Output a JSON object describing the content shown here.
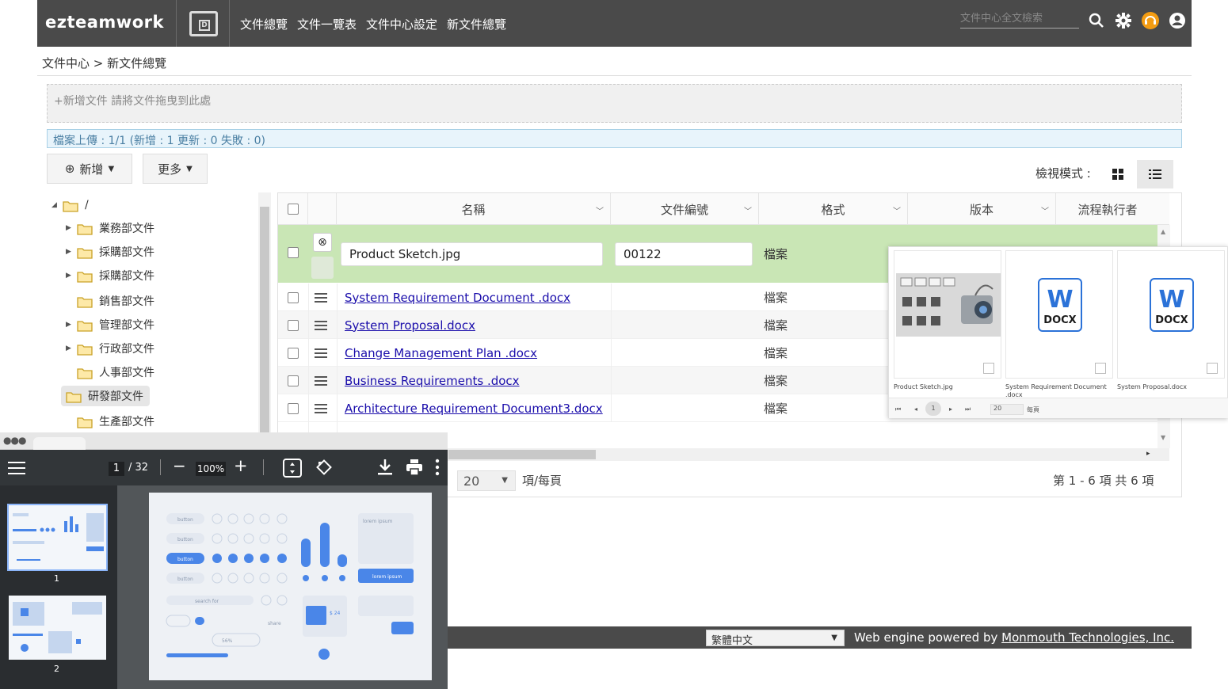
{
  "app": {
    "logo": "ezteamwork",
    "logo_badge": "D",
    "nav": [
      "文件總覽",
      "文件一覽表",
      "文件中心設定",
      "新文件總覽"
    ],
    "search_placeholder": "文件中心全文檢索"
  },
  "breadcrumb": "文件中心 > 新文件總覽",
  "dropzone_text": "+新增文件 請將文件拖曳到此處",
  "upload_status": "檔案上傳 : 1/1 (新增 : 1 更新 : 0 失敗 : 0)",
  "toolbar": {
    "add_label": "新增",
    "more_label": "更多",
    "view_mode_label": "檢視模式 :"
  },
  "tree": {
    "root": "/",
    "items": [
      "業務部文件",
      "採購部文件",
      "採購部文件",
      "銷售部文件",
      "管理部文件",
      "行政部文件",
      "人事部文件",
      "研發部文件",
      "生產部文件"
    ]
  },
  "table": {
    "headers": [
      "名稱",
      "文件編號",
      "格式",
      "版本",
      "流程執行者"
    ],
    "edit_row": {
      "name": "Product Sketch.jpg",
      "number": "00122",
      "format": "檔案"
    },
    "rows": [
      {
        "name": "System Requirement Document .docx",
        "format": "檔案"
      },
      {
        "name": "System Proposal.docx",
        "format": "檔案"
      },
      {
        "name": "Change Management Plan .docx",
        "format": "檔案"
      },
      {
        "name": "Business Requirements .docx",
        "format": "檔案"
      },
      {
        "name": "Architecture Requirement Document3.docx",
        "format": "檔案"
      }
    ],
    "page_size": "20",
    "per_page_label": "項/每頁",
    "summary": "第 1 - 6 項 共 6 項"
  },
  "preview": {
    "cards": [
      {
        "caption": "Product Sketch.jpg"
      },
      {
        "caption": "System Requirement Document .docx",
        "badge": "W",
        "label": "DOCX"
      },
      {
        "caption": "System Proposal.docx",
        "badge": "W",
        "label": "DOCX"
      }
    ],
    "page": "1",
    "page_size": "20",
    "per_page": "每頁"
  },
  "footer": {
    "language": "繁體中文",
    "powered_prefix": "Web engine powered by",
    "powered_link": "Monmouth Technologies, Inc."
  },
  "pdf": {
    "page": "1",
    "total": "/ 32",
    "zoom": "100%",
    "thumbs": [
      "1",
      "2"
    ],
    "page_texts": {
      "button": "button",
      "search": "search for",
      "share": "share",
      "lorem": "lorem ipsum",
      "price": "$ 24",
      "percent": "56%"
    }
  }
}
